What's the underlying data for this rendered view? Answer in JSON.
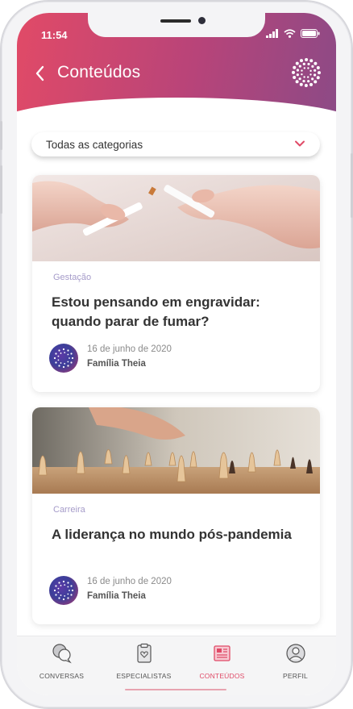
{
  "status": {
    "time": "11:54"
  },
  "header": {
    "title": "Conteúdos"
  },
  "filter": {
    "selected": "Todas as categorias"
  },
  "articles": [
    {
      "category": "Gestação",
      "title": "Estou pensando em engravidar: quando parar de fumar?",
      "date": "16 de junho de 2020",
      "author": "Família Theia",
      "image": "cigarette-breaking-photo"
    },
    {
      "category": "Carreira",
      "title": "A liderança no mundo pós-pandemia",
      "date": "16 de junho de 2020",
      "author": "Família Theia",
      "image": "chess-pieces-photo"
    }
  ],
  "nav": [
    {
      "label": "CONVERSAS",
      "icon": "chat-bubbles-icon",
      "active": false
    },
    {
      "label": "ESPECIALISTAS",
      "icon": "clipboard-heart-icon",
      "active": false
    },
    {
      "label": "CONTEÚDOS",
      "icon": "newspaper-icon",
      "active": true
    },
    {
      "label": "PERFIL",
      "icon": "profile-icon",
      "active": false
    }
  ],
  "colors": {
    "accent": "#e04a67",
    "gradient_start": "#e14a67",
    "gradient_end": "#8c4a86",
    "category": "#a59bc9"
  }
}
